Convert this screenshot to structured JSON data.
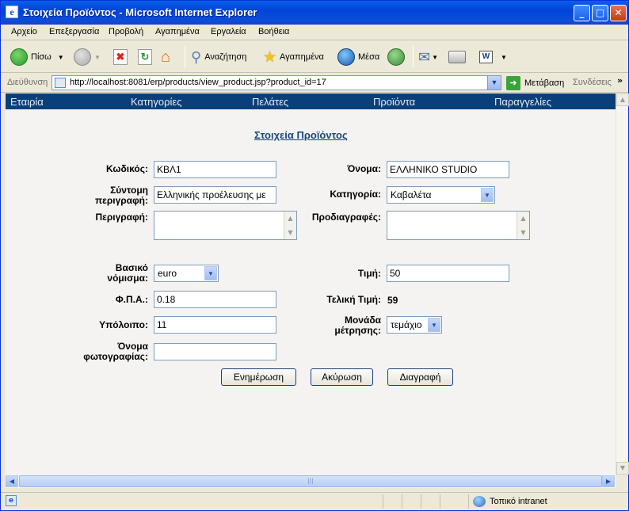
{
  "window": {
    "title": "Στοιχεία Προϊόντος - Microsoft Internet Explorer",
    "minimize": "_",
    "maximize": "□",
    "close": "✕"
  },
  "menu": [
    "Αρχείο",
    "Επεξεργασία",
    "Προβολή",
    "Αγαπημένα",
    "Εργαλεία",
    "Βοήθεια"
  ],
  "toolbar": {
    "back": "Πίσω",
    "search": "Αναζήτηση",
    "favorites": "Αγαπημένα",
    "media": "Μέσα"
  },
  "address": {
    "label": "Διεύθυνση",
    "url": "http://localhost:8081/erp/products/view_product.jsp?product_id=17",
    "go": "Μετάβαση",
    "links": "Συνδέσεις",
    "more": "»"
  },
  "nav": [
    "Εταιρία",
    "Κατηγορίες",
    "Πελάτες",
    "Προϊόντα",
    "Παραγγελίες"
  ],
  "page": {
    "title": "Στοιχεία Προϊόντος"
  },
  "form": {
    "code_label": "Κωδικός:",
    "code_value": "ΚΒΛ1",
    "name_label": "Όνομα:",
    "name_value": "ΕΛΛΗΝΙΚΟ STUDIO",
    "short_desc_label_1": "Σύντομη",
    "short_desc_label_2": "περιγραφή:",
    "short_desc_value": "Ελληνικής προέλευσης με",
    "category_label": "Κατηγορία:",
    "category_value": "Καβαλέτα",
    "description_label": "Περιγραφή:",
    "specs_label": "Προδιαγραφές:",
    "currency_label_1": "Βασικό",
    "currency_label_2": "νόμισμα:",
    "currency_value": "euro",
    "price_label": "Τιμή:",
    "price_value": "50",
    "vat_label": "Φ.Π.Α.:",
    "vat_value": "0.18",
    "final_price_label": "Τελική Τιμή:",
    "final_price_value": "59",
    "stock_label": "Υπόλοιπο:",
    "stock_value": "11",
    "unit_label_1": "Μονάδα",
    "unit_label_2": "μέτρησης:",
    "unit_value": "τεμάχιο",
    "photo_label_1": "Όνομα",
    "photo_label_2": "φωτογραφίας:",
    "photo_value": ""
  },
  "buttons": {
    "update": "Ενημέρωση",
    "cancel": "Ακύρωση",
    "delete": "Διαγραφή"
  },
  "status": {
    "zone": "Τοπικό intranet"
  },
  "colors": {
    "nav_bg": "#0b3f7a",
    "title_link": "#17477f",
    "titlebar": "#0044d9"
  }
}
